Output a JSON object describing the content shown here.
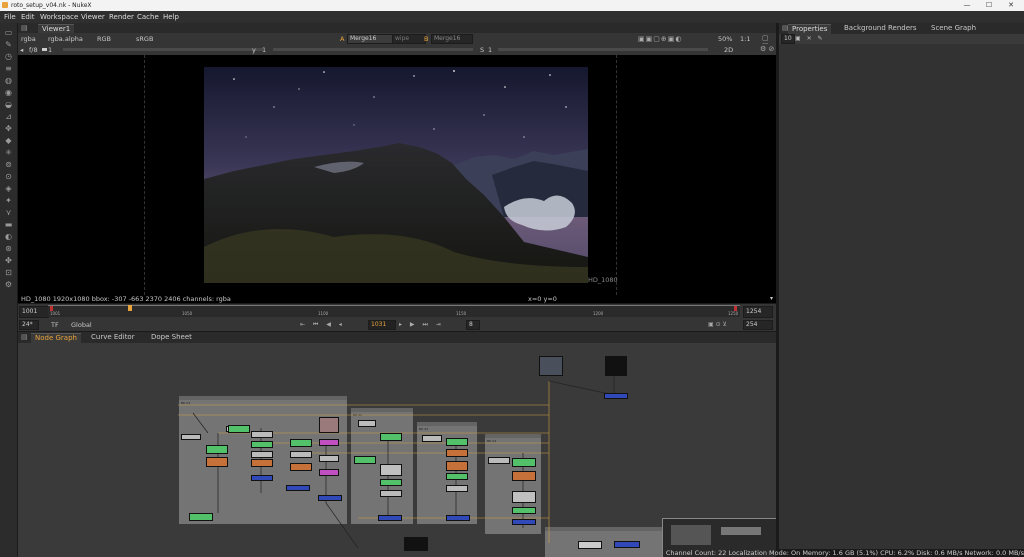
{
  "window": {
    "title": "roto_setup_v04.nk - NukeX"
  },
  "menu": [
    "File",
    "Edit",
    "Workspace",
    "Viewer",
    "Render",
    "Cache",
    "Help"
  ],
  "viewer": {
    "tab": "Viewer1",
    "channels": "rgba",
    "alpha": "rgba.alpha",
    "colorspace_in": "RGB",
    "colorspace_out": "sRGB",
    "a_input": "Merge16",
    "wipe": "wipe",
    "b_input": "Merge16",
    "zoom": "50%",
    "ratio": "1:1",
    "fstop": "f/8",
    "gain": "1",
    "gamma_label": "y",
    "gamma": "1",
    "s_label": "S",
    "s_value": "1",
    "view_mode": "2D",
    "format_label": "HD_1080",
    "info": "HD_1080 1920x1080  bbox: -307 -663 2370 2406 channels: rgba",
    "coords": "x=0 y=0"
  },
  "timeline": {
    "start": "1001",
    "end": "1254",
    "ticks": [
      "1001",
      "1050",
      "1100",
      "1150",
      "1200",
      "1250"
    ],
    "fps": "24*",
    "tf": "TF",
    "mode": "Global",
    "current_frame": "1031",
    "step": "8",
    "end_field": "254"
  },
  "node_tabs": [
    "Node Graph",
    "Curve Editor",
    "Dope Sheet"
  ],
  "right_panel": {
    "tabs": [
      "Properties",
      "Background Renders",
      "Scene Graph"
    ],
    "max_panels": "10"
  },
  "status": "Channel Count: 22  Localization Mode: On  Memory: 1.6 GB (5.1%)  CPU: 6.2%  Disk: 0.6 MB/s  Network: 0.0 MB/s",
  "colors": {
    "accent": "#e8a33a",
    "node_green": "#53c16a",
    "node_blue": "#3048b8",
    "node_orange": "#c6703a",
    "backdrop": "#747474"
  }
}
